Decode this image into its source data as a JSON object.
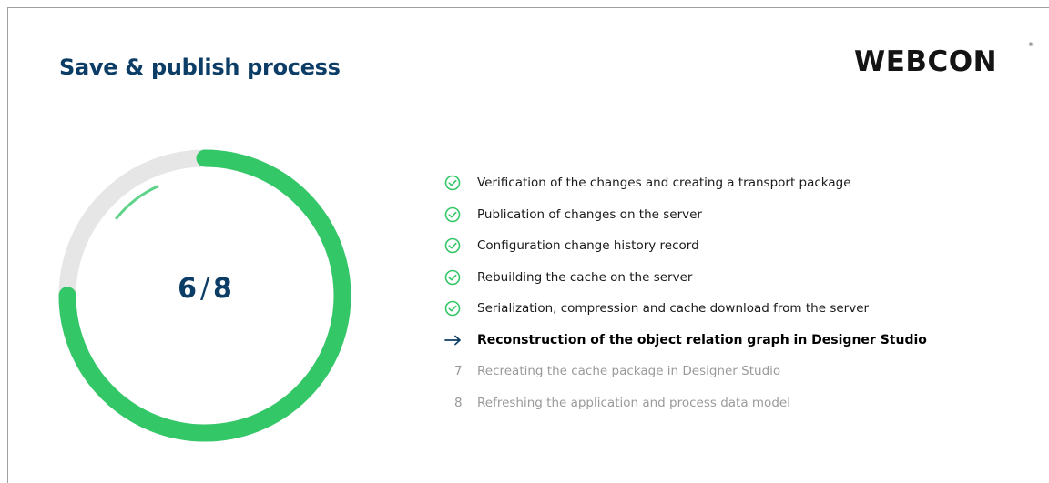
{
  "header": {
    "title": "Save & publish process"
  },
  "logo": {
    "text": "WEBCON",
    "reg_mark": "®"
  },
  "progress": {
    "current": "6",
    "separator": "/",
    "total": "8",
    "fraction": 0.75,
    "colors": {
      "track": "#e6e6e6",
      "fill": "#34c768",
      "accent": "#0c3d66"
    }
  },
  "steps": [
    {
      "label": "Verification of the changes and creating a transport package",
      "state": "done"
    },
    {
      "label": "Publication of changes on the server",
      "state": "done"
    },
    {
      "label": "Configuration change history record",
      "state": "done"
    },
    {
      "label": "Rebuilding the cache on the server",
      "state": "done"
    },
    {
      "label": "Serialization, compression and cache download from the server",
      "state": "done"
    },
    {
      "label": "Reconstruction of the object relation graph in Designer Studio",
      "state": "active"
    },
    {
      "label": "Recreating the cache package in Designer Studio",
      "state": "pending",
      "number": "7"
    },
    {
      "label": "Refreshing the application and process data model",
      "state": "pending",
      "number": "8"
    }
  ]
}
